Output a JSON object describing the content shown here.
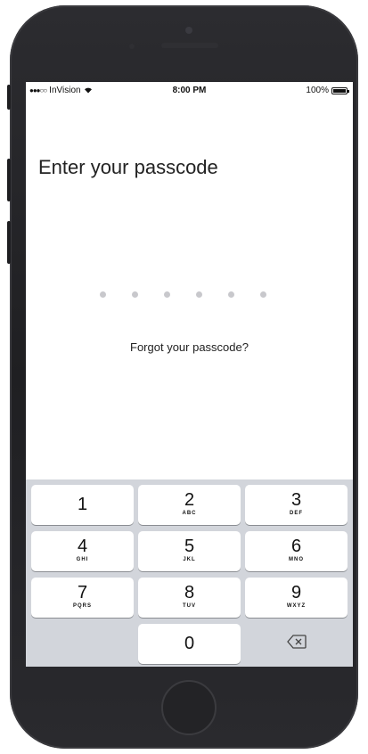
{
  "status_bar": {
    "carrier": "InVision",
    "time": "8:00 PM",
    "battery": "100%",
    "signal": "●●●○○"
  },
  "title": "Enter your passcode",
  "passcode_length": 6,
  "forgot_link": "Forgot your passcode?",
  "keypad": {
    "keys": [
      {
        "digit": "1",
        "letters": ""
      },
      {
        "digit": "2",
        "letters": "ABC"
      },
      {
        "digit": "3",
        "letters": "DEF"
      },
      {
        "digit": "4",
        "letters": "GHI"
      },
      {
        "digit": "5",
        "letters": "JKL"
      },
      {
        "digit": "6",
        "letters": "MNO"
      },
      {
        "digit": "7",
        "letters": "PQRS"
      },
      {
        "digit": "8",
        "letters": "TUV"
      },
      {
        "digit": "9",
        "letters": "WXYZ"
      },
      {
        "digit": "0",
        "letters": ""
      }
    ],
    "delete_icon": "backspace-icon"
  },
  "colors": {
    "phone_body": "#2c2c30",
    "keypad_bg": "#d2d5db",
    "dot_empty": "#c8c8cc"
  }
}
